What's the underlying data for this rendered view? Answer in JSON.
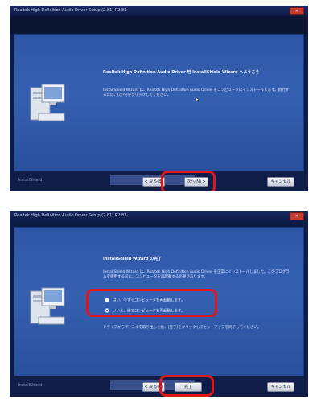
{
  "screen1": {
    "title": "Realtek High Definition Audio Driver Setup (2.81) R2.81",
    "welcome_heading": "Realtek High Definition Audio Driver 用 InstallShield Wizard へようこそ",
    "welcome_body": "InstallShield Wizard は、Realtek High Definition Audio Driver をコンピュータにインストールします。続行するには、[次へ]をクリックしてください。",
    "footer_brand": "InstallShield",
    "back_label": "< 戻る(B)",
    "next_label": "次へ(N) >",
    "cancel_label": "キャンセル"
  },
  "screen2": {
    "title": "Realtek High Definition Audio Driver Setup (2.81) R2.81",
    "complete_heading": "InstallShield Wizard の完了",
    "complete_body": "InstallShield Wizard は、Realtek High Definition Audio Driver を正常にインストールしました。このプログラムを使用する前に、コンピュータを再起動する必要があります。",
    "option_restart_now": "はい、今すぐコンピュータを再起動します。",
    "option_restart_later": "いいえ、後でコンピュータを再起動します。",
    "remove_media_note": "ドライブからディスクを取り出した後、[完了]をクリックしてセットアップを終了してください。",
    "footer_brand": "InstallShield",
    "back_label": "< 戻る(B)",
    "finish_label": "完了",
    "cancel_label": "キャンセル"
  },
  "colors": {
    "highlight": "#e0161a",
    "panel": "#3560b1",
    "frame": "#0d1c44"
  }
}
